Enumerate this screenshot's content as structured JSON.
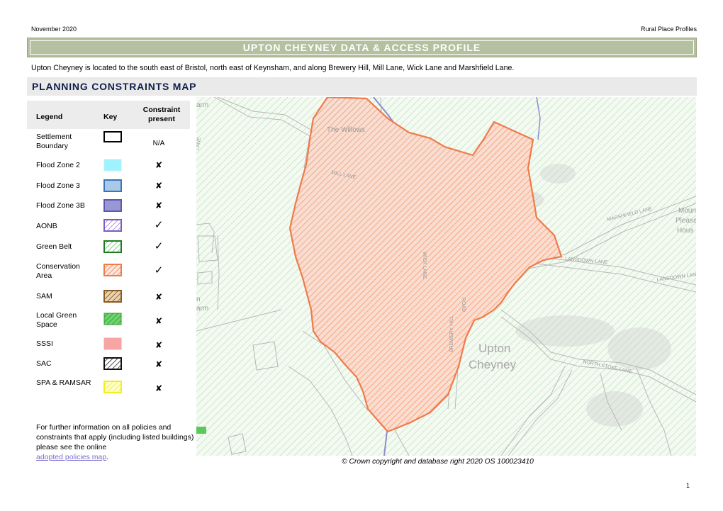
{
  "header": {
    "date": "November 2020",
    "series": "Rural Place Profiles"
  },
  "title": "UPTON CHEYNEY DATA & ACCESS PROFILE",
  "intro": "Upton Cheyney is located to the south east of Bristol, north east of Keynsham, and along Brewery Hill, Mill Lane, Wick Lane and Marshfield Lane.",
  "section_title": "PLANNING CONSTRAINTS MAP",
  "legend": {
    "col_legend": "Legend",
    "col_key": "Key",
    "col_present": "Constraint present",
    "rows": [
      {
        "name": "Settlement Boundary",
        "present": "N/A",
        "key_icon": "outline-black"
      },
      {
        "name": "Flood Zone 2",
        "present": "✘",
        "key_icon": "fill-light-cyan"
      },
      {
        "name": "Flood Zone 3",
        "present": "✘",
        "key_icon": "fill-light-blue"
      },
      {
        "name": "Flood Zone 3B",
        "present": "✘",
        "key_icon": "fill-purple-blue"
      },
      {
        "name": "AONB",
        "present": "✓",
        "key_icon": "hatch-purple"
      },
      {
        "name": "Green Belt",
        "present": "✓",
        "key_icon": "hatch-green"
      },
      {
        "name": "Conservation Area",
        "present": "✓",
        "key_icon": "hatch-orange"
      },
      {
        "name": "SAM",
        "present": "✘",
        "key_icon": "hatch-brown"
      },
      {
        "name": "Local Green Space",
        "present": "✘",
        "key_icon": "hatch-dark-green"
      },
      {
        "name": "SSSI",
        "present": "✘",
        "key_icon": "fill-pink"
      },
      {
        "name": "SAC",
        "present": "✘",
        "key_icon": "hatch-black"
      },
      {
        "name": "SPA & RAMSAR",
        "present": "✘",
        "key_icon": "hatch-yellow"
      }
    ],
    "further_info": "For further information on all policies and constraints that apply (including listed buildings) please see the online",
    "link_text": "adopted policies map",
    "link_suffix": "."
  },
  "map": {
    "labels": {
      "the_willows": "The Willows",
      "mill_lane": "MILL LANE",
      "marshfield_lane": "MARSHFIELD LANE",
      "lansdown_lane_1": "LANSDOWN LANE",
      "lansdown_lane_2": "LANSDOWN LANE",
      "north_stoke_lane": "NORTH STOKE LANE",
      "brewery_hill": "BREWERY HILL",
      "upton": "Upton",
      "cheyney": "Cheyney",
      "mount_pleasant_1": "Moun",
      "mount_pleasant_2": "Pleasa",
      "mount_pleasant_3": "Hous",
      "farm_1": "arm",
      "farm_2": "n",
      "farm_3": "arm",
      "lane_west": "LANE",
      "wick_lane": "WICK LANE",
      "road_mid": "ROAD"
    },
    "colors": {
      "green_belt": "#8fd08f",
      "conservation": "#f07a4a",
      "road": "#c8c8c8",
      "aonb_line": "#8c8ccf"
    }
  },
  "copyright": "© Crown copyright and database right 2020 OS 100023410",
  "page_number": "1"
}
